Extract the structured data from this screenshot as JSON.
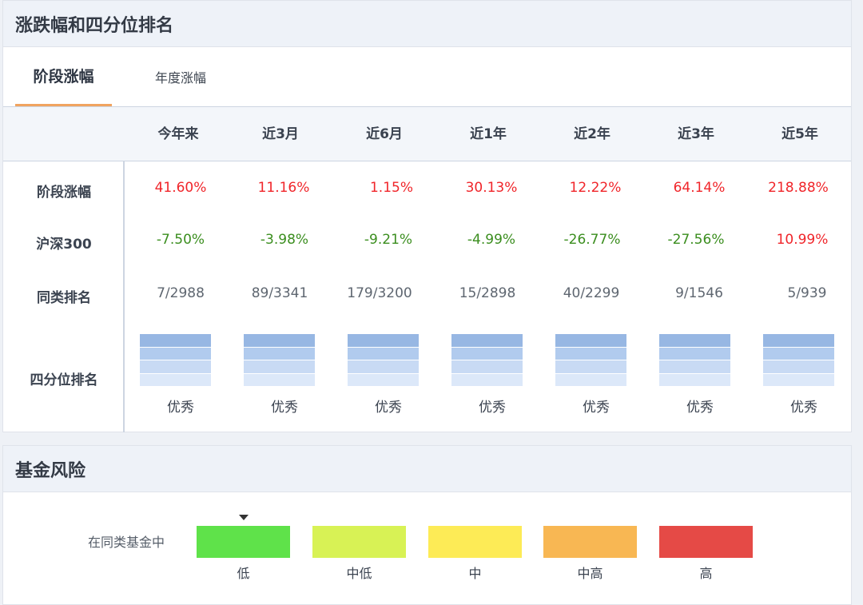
{
  "section1": {
    "title": "涨跌幅和四分位排名",
    "tabs": [
      {
        "label": "阶段涨幅",
        "active": true
      },
      {
        "label": "年度涨幅",
        "active": false
      }
    ],
    "columns": [
      "今年来",
      "近3月",
      "近6月",
      "近1年",
      "近2年",
      "近3年",
      "近5年"
    ],
    "rows": {
      "stage_label": "阶段涨幅",
      "stage": [
        "41.60%",
        "11.16%",
        "1.15%",
        "30.13%",
        "12.22%",
        "64.14%",
        "218.88%"
      ],
      "hs300_label": "沪深300",
      "hs300": [
        "-7.50%",
        "-3.98%",
        "-9.21%",
        "-4.99%",
        "-26.77%",
        "-27.56%",
        "10.99%"
      ],
      "rank_label": "同类排名",
      "rank": [
        "7/2988",
        "89/3341",
        "179/3200",
        "15/2898",
        "40/2299",
        "9/1546",
        "5/939"
      ],
      "quartile_label": "四分位排名",
      "quartile": [
        "优秀",
        "优秀",
        "优秀",
        "优秀",
        "优秀",
        "优秀",
        "优秀"
      ]
    },
    "colors": {
      "positive": "#f0252a",
      "negative": "#3b8e1f",
      "tab_underline": "#f0a35f"
    }
  },
  "section2": {
    "title": "基金风险",
    "compare_label": "在同类基金中",
    "levels": [
      {
        "label": "低",
        "color": "#5fe24a"
      },
      {
        "label": "中低",
        "color": "#d8f255"
      },
      {
        "label": "中",
        "color": "#fdeb56"
      },
      {
        "label": "中高",
        "color": "#f8b753"
      },
      {
        "label": "高",
        "color": "#e54a46"
      }
    ],
    "selected_index": 0
  }
}
